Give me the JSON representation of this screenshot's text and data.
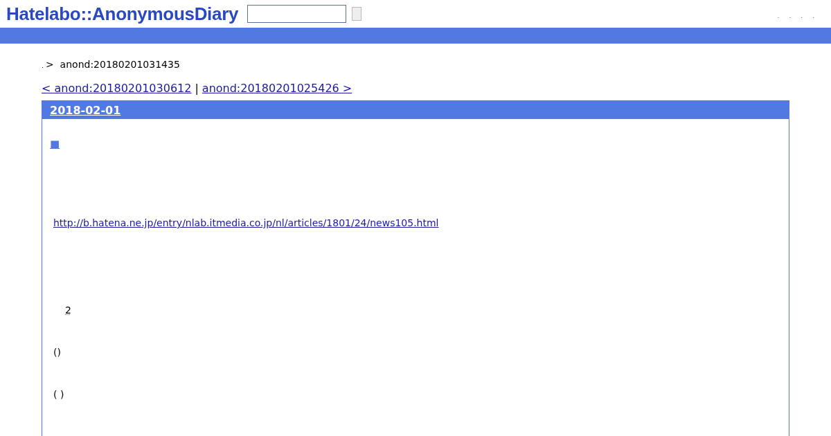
{
  "header": {
    "logo": "Hatelabo::AnonymousDiary",
    "links": [
      ".",
      ".",
      ".",
      "."
    ]
  },
  "breadcrumb": {
    "home": ".",
    "separator": ">",
    "current": "anond:20180201031435"
  },
  "pager": {
    "prev": "< anond:20180201030612",
    "separator": "|",
    "next": "anond:20180201025426 >"
  },
  "entry": {
    "date": "2018-02-01",
    "title_mark": "■",
    "paragraphs": [
      {
        "kind": "link",
        "text": "http://b.hatena.ne.jp/entry/nlab.itmedia.co.jp/nl/articles/1801/24/news105.html"
      },
      {
        "kind": "footnote",
        "text": "2"
      },
      {
        "kind": "text",
        "text": "()"
      },
      {
        "kind": "text",
        "text": "( )"
      }
    ]
  }
}
